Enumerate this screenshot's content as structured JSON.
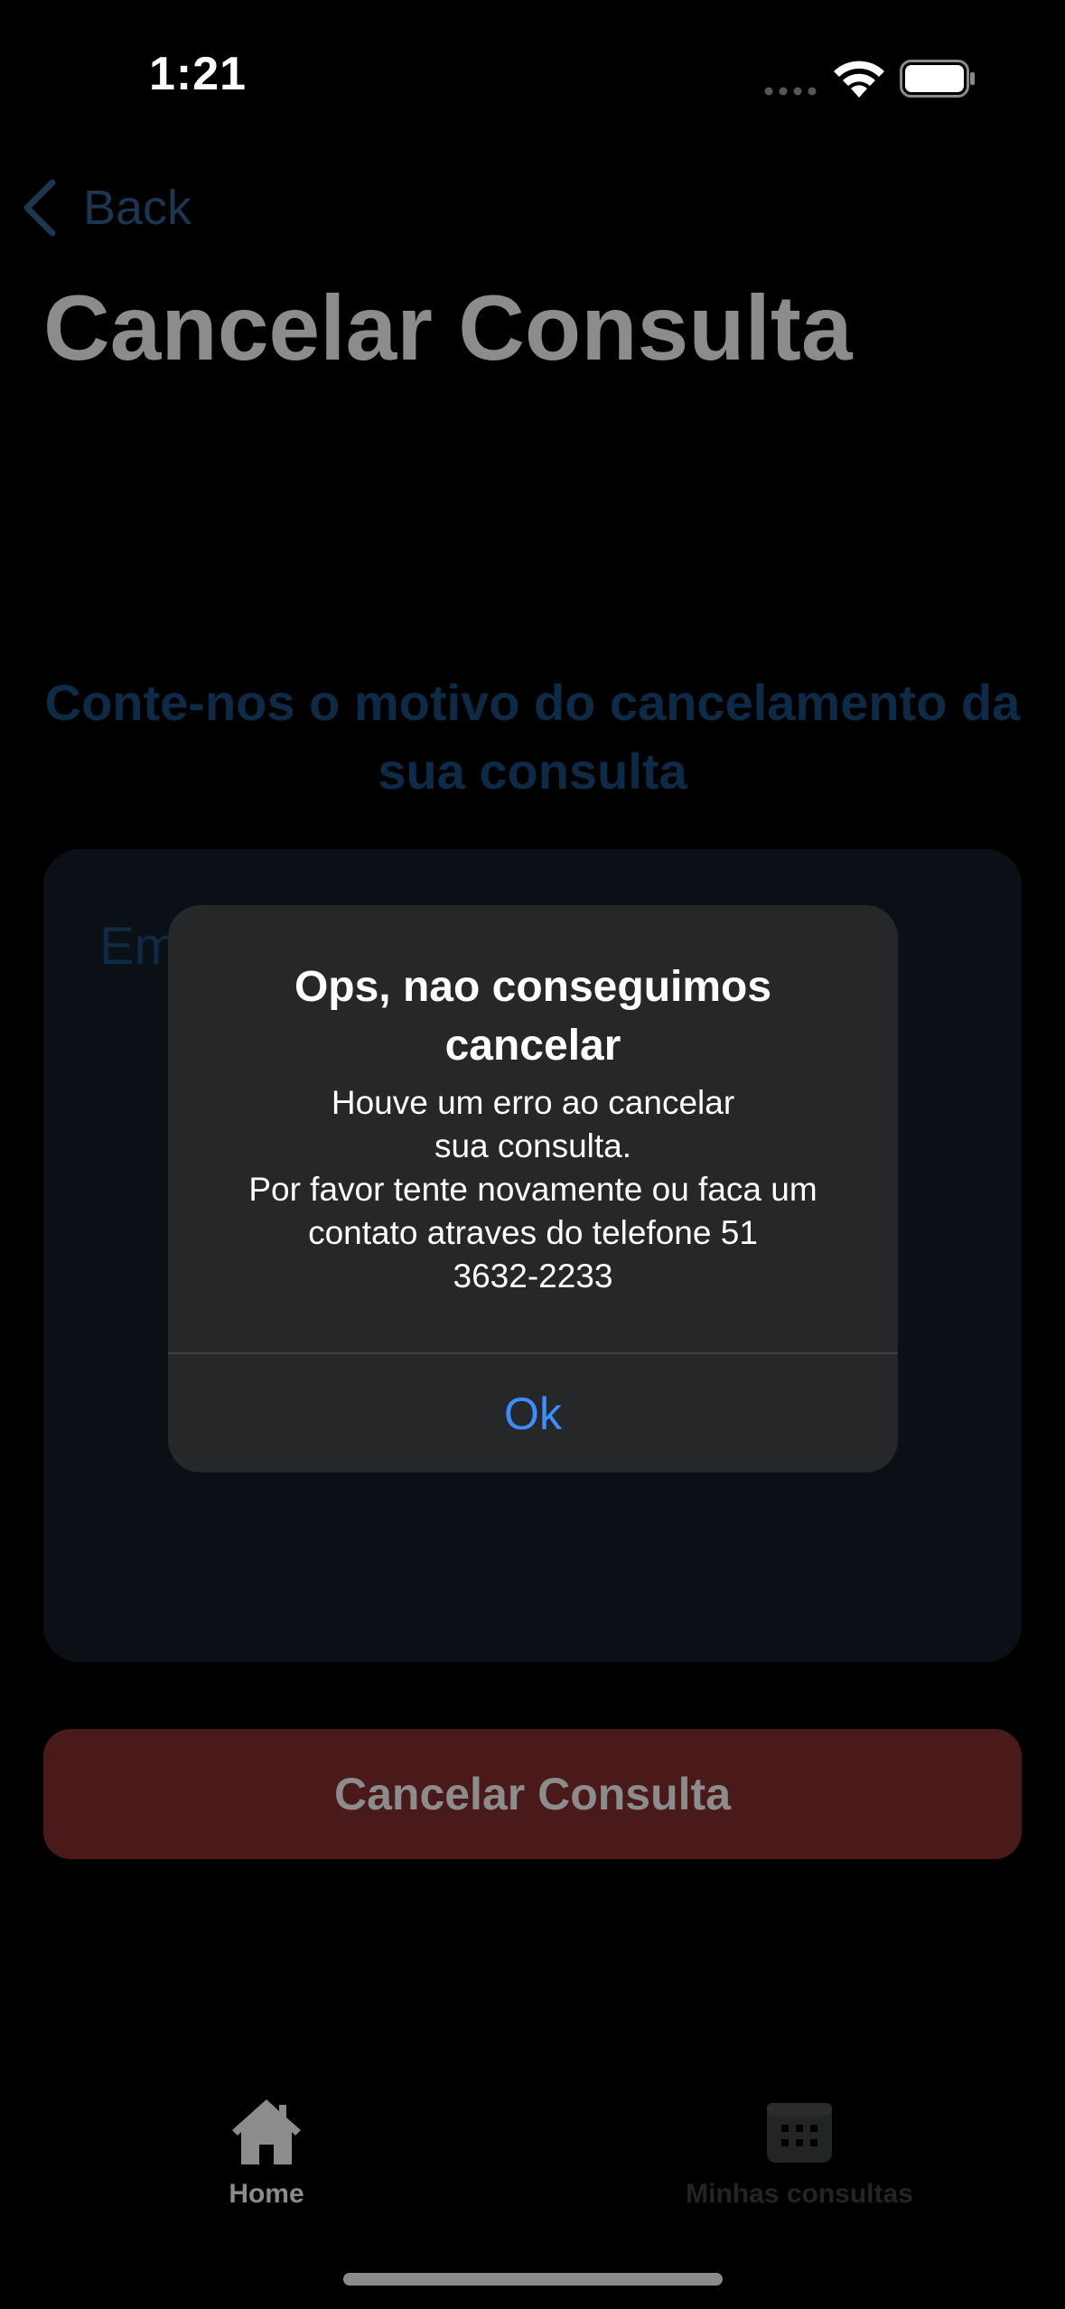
{
  "status_bar": {
    "time": "1:21"
  },
  "nav": {
    "back_label": "Back",
    "title": "Cancelar Consulta"
  },
  "form": {
    "prompt": "Conte-nos o motivo do cancelamento da sua consulta",
    "reason_placeholder": "Em",
    "cancel_button_label": "Cancelar Consulta"
  },
  "alert": {
    "title": "Ops, nao conseguimos cancelar",
    "message_lines": [
      "Houve um erro ao cancelar",
      "sua consulta.",
      "Por favor tente novamente ou faca um",
      "contato atraves do telefone 51",
      "3632-2233"
    ],
    "ok_label": "Ok"
  },
  "tab_bar": {
    "items": [
      {
        "label": "Home",
        "icon": "house-icon",
        "selected": true
      },
      {
        "label": "Minhas consultas",
        "icon": "calendar-icon",
        "selected": false
      }
    ]
  },
  "colors": {
    "background": "#000000",
    "alert_background": "#262728",
    "accent_blue": "#3c8dff",
    "cancel_button": "#4a1a1b"
  }
}
